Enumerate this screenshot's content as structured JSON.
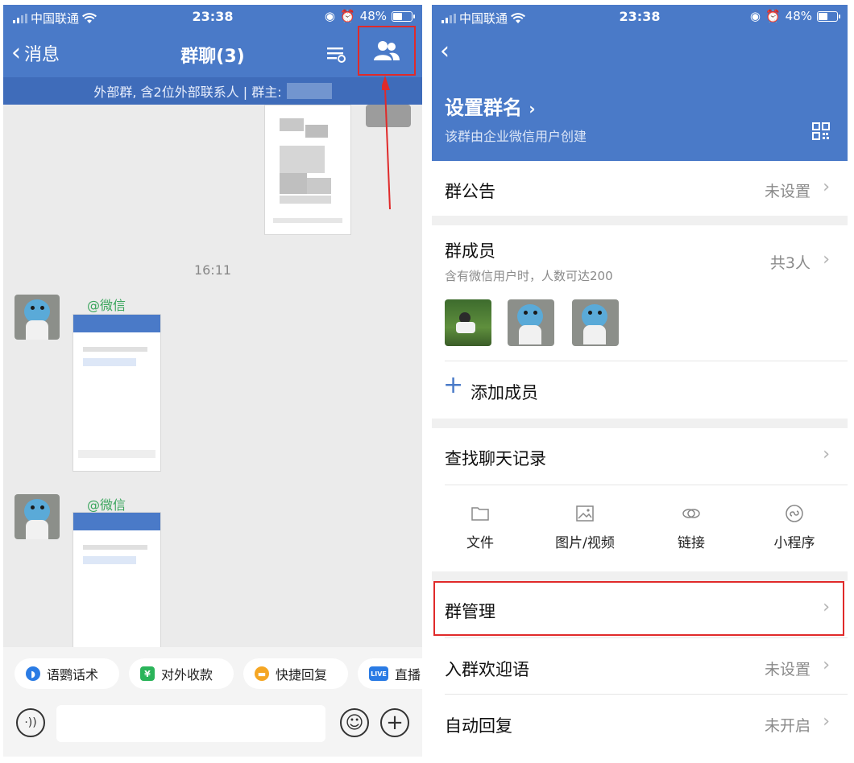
{
  "left": {
    "status": {
      "carrier": "中国联通",
      "time": "23:38",
      "battery": "48%"
    },
    "nav": {
      "back_label": "消息",
      "title": "群聊(3)"
    },
    "banner": "外部群, 含2位外部联系人 | 群主:",
    "time_label": "16:11",
    "messages": [
      {
        "sender": "@微信"
      },
      {
        "sender": "@微信"
      }
    ],
    "quick_actions": [
      {
        "label": "语鹦话术",
        "icon": "parrot-icon",
        "color": "#2a7be4"
      },
      {
        "label": "对外收款",
        "icon": "payment-shield-icon",
        "color": "#2bb45a"
      },
      {
        "label": "快捷回复",
        "icon": "quick-reply-icon",
        "color": "#f5a623"
      },
      {
        "label": "直播",
        "icon": "live-icon",
        "color": "#2a7be4",
        "badge": "LIVE"
      }
    ]
  },
  "right": {
    "status": {
      "carrier": "中国联通",
      "time": "23:38",
      "battery": "48%"
    },
    "group_name": "设置群名",
    "group_sub": "该群由企业微信用户创建",
    "announcement": {
      "label": "群公告",
      "value": "未设置"
    },
    "members": {
      "label": "群成员",
      "sub": "含有微信用户时，人数可达200",
      "value": "共3人"
    },
    "add_member": "添加成员",
    "search_history": "查找聊天记录",
    "tools": [
      {
        "label": "文件",
        "icon": "folder-icon"
      },
      {
        "label": "图片/视频",
        "icon": "image-icon"
      },
      {
        "label": "链接",
        "icon": "link-icon"
      },
      {
        "label": "小程序",
        "icon": "mini-program-icon"
      }
    ],
    "group_manage": "群管理",
    "welcome": {
      "label": "入群欢迎语",
      "value": "未设置"
    },
    "auto_reply": {
      "label": "自动回复",
      "value": "未开启"
    }
  },
  "colors": {
    "brand": "#4a7ac8",
    "highlight": "#e02a2a",
    "sender": "#3aa55c"
  }
}
